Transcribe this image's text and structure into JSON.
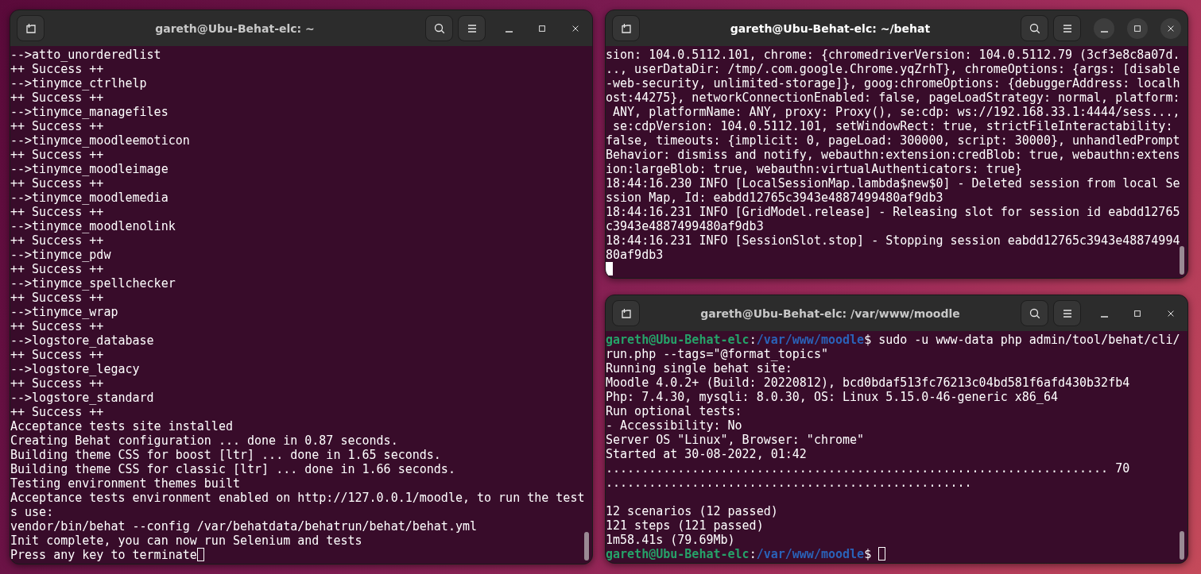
{
  "windows": [
    {
      "title": "gareth@Ubu-Behat-elc: ~",
      "focused": false,
      "lines": [
        {
          "kind": "text",
          "text": "-->atto_unorderedlist"
        },
        {
          "kind": "text",
          "text": "++ Success ++"
        },
        {
          "kind": "text",
          "text": "-->tinymce_ctrlhelp"
        },
        {
          "kind": "text",
          "text": "++ Success ++"
        },
        {
          "kind": "text",
          "text": "-->tinymce_managefiles"
        },
        {
          "kind": "text",
          "text": "++ Success ++"
        },
        {
          "kind": "text",
          "text": "-->tinymce_moodleemoticon"
        },
        {
          "kind": "text",
          "text": "++ Success ++"
        },
        {
          "kind": "text",
          "text": "-->tinymce_moodleimage"
        },
        {
          "kind": "text",
          "text": "++ Success ++"
        },
        {
          "kind": "text",
          "text": "-->tinymce_moodlemedia"
        },
        {
          "kind": "text",
          "text": "++ Success ++"
        },
        {
          "kind": "text",
          "text": "-->tinymce_moodlenolink"
        },
        {
          "kind": "text",
          "text": "++ Success ++"
        },
        {
          "kind": "text",
          "text": "-->tinymce_pdw"
        },
        {
          "kind": "text",
          "text": "++ Success ++"
        },
        {
          "kind": "text",
          "text": "-->tinymce_spellchecker"
        },
        {
          "kind": "text",
          "text": "++ Success ++"
        },
        {
          "kind": "text",
          "text": "-->tinymce_wrap"
        },
        {
          "kind": "text",
          "text": "++ Success ++"
        },
        {
          "kind": "text",
          "text": "-->logstore_database"
        },
        {
          "kind": "text",
          "text": "++ Success ++"
        },
        {
          "kind": "text",
          "text": "-->logstore_legacy"
        },
        {
          "kind": "text",
          "text": "++ Success ++"
        },
        {
          "kind": "text",
          "text": "-->logstore_standard"
        },
        {
          "kind": "text",
          "text": "++ Success ++"
        },
        {
          "kind": "text",
          "text": "Acceptance tests site installed"
        },
        {
          "kind": "text",
          "text": "Creating Behat configuration ... done in 0.87 seconds."
        },
        {
          "kind": "text",
          "text": "Building theme CSS for boost [ltr] ... done in 1.65 seconds."
        },
        {
          "kind": "text",
          "text": "Building theme CSS for classic [ltr] ... done in 1.66 seconds."
        },
        {
          "kind": "text",
          "text": "Testing environment themes built"
        },
        {
          "kind": "text",
          "text": "Acceptance tests environment enabled on http://127.0.0.1/moodle, to run the test"
        },
        {
          "kind": "text",
          "text": "s use:"
        },
        {
          "kind": "text",
          "text": "vendor/bin/behat --config /var/behatdata/behatrun/behat/behat.yml"
        },
        {
          "kind": "text",
          "text": "Init complete, you can now run Selenium and tests"
        },
        {
          "kind": "text",
          "text": "Press any key to terminate",
          "cursor": true
        }
      ]
    },
    {
      "title": "gareth@Ubu-Behat-elc: ~/behat",
      "focused": true,
      "lines": [
        {
          "kind": "text",
          "text": "sion: 104.0.5112.101, chrome: {chromedriverVersion: 104.0.5112.79 (3cf3e8c8a07d."
        },
        {
          "kind": "text",
          "text": ".., userDataDir: /tmp/.com.google.Chrome.yqZrhT}, chromeOptions: {args: [disable"
        },
        {
          "kind": "text",
          "text": "-web-security, unlimited-storage]}, goog:chromeOptions: {debuggerAddress: localh"
        },
        {
          "kind": "text",
          "text": "ost:44275}, networkConnectionEnabled: false, pageLoadStrategy: normal, platform:"
        },
        {
          "kind": "text",
          "text": " ANY, platformName: ANY, proxy: Proxy(), se:cdp: ws://192.168.33.1:4444/sess...,"
        },
        {
          "kind": "text",
          "text": " se:cdpVersion: 104.0.5112.101, setWindowRect: true, strictFileInteractability:"
        },
        {
          "kind": "text",
          "text": "false, timeouts: {implicit: 0, pageLoad: 300000, script: 30000}, unhandledPrompt"
        },
        {
          "kind": "text",
          "text": "Behavior: dismiss and notify, webauthn:extension:credBlob: true, webauthn:extens"
        },
        {
          "kind": "text",
          "text": "ion:largeBlob: true, webauthn:virtualAuthenticators: true}"
        },
        {
          "kind": "text",
          "text": "18:44:16.230 INFO [LocalSessionMap.lambda$new$0] - Deleted session from local Se"
        },
        {
          "kind": "text",
          "text": "ssion Map, Id: eabdd12765c3943e4887499480af9db3"
        },
        {
          "kind": "text",
          "text": "18:44:16.231 INFO [GridModel.release] - Releasing slot for session id eabdd12765"
        },
        {
          "kind": "text",
          "text": "c3943e4887499480af9db3"
        },
        {
          "kind": "text",
          "text": "18:44:16.231 INFO [SessionSlot.stop] - Stopping session eabdd12765c3943e48874994"
        },
        {
          "kind": "text",
          "text": "80af9db3"
        },
        {
          "kind": "cursor"
        }
      ]
    },
    {
      "title": "gareth@Ubu-Behat-elc: /var/www/moodle",
      "focused": false,
      "lines": [
        {
          "kind": "prompt",
          "user": "gareth@Ubu-Behat-elc",
          "separator": ":",
          "path": "/var/www/moodle",
          "symbol": "$",
          "command": "sudo -u www-data php admin/tool/behat/cli/"
        },
        {
          "kind": "text",
          "text": "run.php --tags=\"@format_topics\""
        },
        {
          "kind": "text",
          "text": "Running single behat site:"
        },
        {
          "kind": "text",
          "text": "Moodle 4.0.2+ (Build: 20220812), bcd0bdaf513fc76213c04bd581f6afd430b32fb4"
        },
        {
          "kind": "text",
          "text": "Php: 7.4.30, mysqli: 8.0.30, OS: Linux 5.15.0-46-generic x86_64"
        },
        {
          "kind": "text",
          "text": "Run optional tests:"
        },
        {
          "kind": "text",
          "text": "- Accessibility: No"
        },
        {
          "kind": "text",
          "text": "Server OS \"Linux\", Browser: \"chrome\""
        },
        {
          "kind": "text",
          "text": "Started at 30-08-2022, 01:42"
        },
        {
          "kind": "text",
          "text": "...................................................................... 70"
        },
        {
          "kind": "text",
          "text": "..................................................."
        },
        {
          "kind": "blank"
        },
        {
          "kind": "text",
          "text": "12 scenarios (12 passed)"
        },
        {
          "kind": "text",
          "text": "121 steps (121 passed)"
        },
        {
          "kind": "text",
          "text": "1m58.41s (79.69Mb)"
        },
        {
          "kind": "prompt",
          "user": "gareth@Ubu-Behat-elc",
          "separator": ":",
          "path": "/var/www/moodle",
          "symbol": "$",
          "cursor": true
        }
      ]
    }
  ]
}
